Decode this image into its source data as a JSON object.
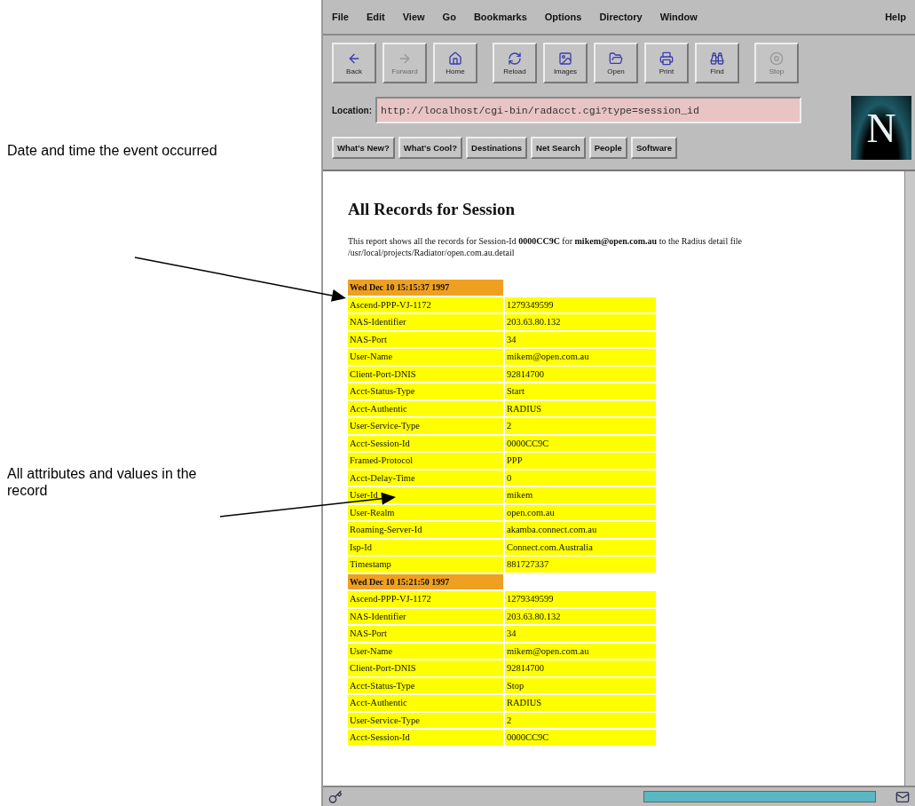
{
  "annotations": [
    {
      "text": "Date and time the event occurred"
    },
    {
      "text": "All attributes and values in the record"
    }
  ],
  "menu": [
    "File",
    "Edit",
    "View",
    "Go",
    "Bookmarks",
    "Options",
    "Directory",
    "Window",
    "Help"
  ],
  "toolbar": [
    {
      "kind": "back",
      "label": "Back",
      "disabled": false
    },
    {
      "kind": "forward",
      "label": "Forward",
      "disabled": true
    },
    {
      "kind": "home",
      "label": "Home",
      "disabled": false
    },
    {
      "kind": "reload",
      "label": "Reload",
      "disabled": false
    },
    {
      "kind": "images",
      "label": "Images",
      "disabled": false
    },
    {
      "kind": "open",
      "label": "Open",
      "disabled": false
    },
    {
      "kind": "print",
      "label": "Print",
      "disabled": false
    },
    {
      "kind": "find",
      "label": "Find",
      "disabled": false
    },
    {
      "kind": "stop",
      "label": "Stop",
      "disabled": true
    }
  ],
  "logo": {
    "letter": "N"
  },
  "location": {
    "label": "Location:",
    "value": "http://localhost/cgi-bin/radacct.cgi?type=session_id"
  },
  "directory_buttons": [
    "What's New?",
    "What's Cool?",
    "Destinations",
    "Net Search",
    "People",
    "Software"
  ],
  "page": {
    "heading": "All Records for Session",
    "intro": "This report shows all the records for Session-Id **0000CC9C** for **mikem@open.com.au** to the Radius detail file /usr/local/projects/Radiator/open.com.au.detail",
    "records": [
      {
        "timestamp": "Wed Dec 10 15:15:37 1997",
        "attributes": [
          {
            "name": "Ascend-PPP-VJ-1172",
            "value": "1279349599"
          },
          {
            "name": "NAS-Identifier",
            "value": "203.63.80.132"
          },
          {
            "name": "NAS-Port",
            "value": "34"
          },
          {
            "name": "User-Name",
            "value": "mikem@open.com.au"
          },
          {
            "name": "Client-Port-DNIS",
            "value": "92814700"
          },
          {
            "name": "Acct-Status-Type",
            "value": "Start"
          },
          {
            "name": "Acct-Authentic",
            "value": "RADIUS"
          },
          {
            "name": "User-Service-Type",
            "value": "2"
          },
          {
            "name": "Acct-Session-Id",
            "value": "0000CC9C"
          },
          {
            "name": "Framed-Protocol",
            "value": "PPP"
          },
          {
            "name": "Acct-Delay-Time",
            "value": "0"
          },
          {
            "name": "User-Id",
            "value": "mikem"
          },
          {
            "name": "User-Realm",
            "value": "open.com.au"
          },
          {
            "name": "Roaming-Server-Id",
            "value": "akamba.connect.com.au"
          },
          {
            "name": "Isp-Id",
            "value": "Connect.com.Australia"
          },
          {
            "name": "Timestamp",
            "value": "881727337"
          }
        ]
      },
      {
        "timestamp": "Wed Dec 10 15:21:50 1997",
        "attributes": [
          {
            "name": "Ascend-PPP-VJ-1172",
            "value": "1279349599"
          },
          {
            "name": "NAS-Identifier",
            "value": "203.63.80.132"
          },
          {
            "name": "NAS-Port",
            "value": "34"
          },
          {
            "name": "User-Name",
            "value": "mikem@open.com.au"
          },
          {
            "name": "Client-Port-DNIS",
            "value": "92814700"
          },
          {
            "name": "Acct-Status-Type",
            "value": "Stop"
          },
          {
            "name": "Acct-Authentic",
            "value": "RADIUS"
          },
          {
            "name": "User-Service-Type",
            "value": "2"
          },
          {
            "name": "Acct-Session-Id",
            "value": "0000CC9C"
          }
        ]
      }
    ]
  },
  "status_bar": {
    "progress": {
      "level": 1
    }
  }
}
